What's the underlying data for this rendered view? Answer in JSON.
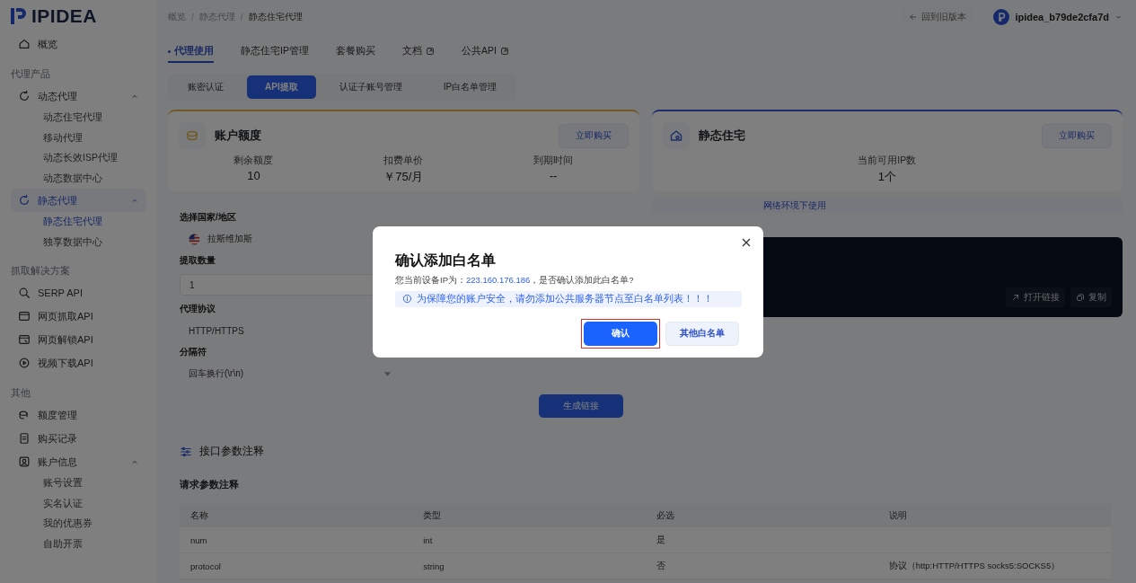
{
  "sidebar": {
    "logo": "IPIDEA",
    "items": [
      {
        "kind": "link",
        "label": "概览",
        "selected": false
      },
      {
        "kind": "section",
        "label": "代理产品"
      },
      {
        "kind": "group",
        "label": "动态代理",
        "expanded": true,
        "selected": false,
        "children": [
          {
            "label": "动态住宅代理",
            "selected": false
          },
          {
            "label": "移动代理",
            "selected": false
          },
          {
            "label": "动态长效ISP代理",
            "selected": false
          },
          {
            "label": "动态数据中心",
            "selected": false
          }
        ]
      },
      {
        "kind": "group",
        "label": "静态代理",
        "expanded": true,
        "selected": true,
        "children": [
          {
            "label": "静态住宅代理",
            "selected": true
          },
          {
            "label": "独享数据中心",
            "selected": false
          }
        ]
      },
      {
        "kind": "section",
        "label": "抓取解决方案"
      },
      {
        "kind": "link",
        "label": "SERP API",
        "selected": false
      },
      {
        "kind": "link",
        "label": "网页抓取API",
        "selected": false
      },
      {
        "kind": "link",
        "label": "网页解锁API",
        "selected": false
      },
      {
        "kind": "link",
        "label": "视频下载API",
        "selected": false
      },
      {
        "kind": "section",
        "label": "其他"
      },
      {
        "kind": "link",
        "label": "额度管理",
        "selected": false
      },
      {
        "kind": "link",
        "label": "购买记录",
        "selected": false
      },
      {
        "kind": "group",
        "label": "账户信息",
        "expanded": true,
        "selected": false,
        "children": [
          {
            "label": "账号设置",
            "selected": false
          },
          {
            "label": "实名认证",
            "selected": false
          },
          {
            "label": "我的优惠券",
            "selected": false
          },
          {
            "label": "自助开票",
            "selected": false
          }
        ]
      }
    ]
  },
  "topbar": {
    "breadcrumb": [
      "概览",
      "静态代理",
      "静态住宅代理"
    ],
    "separator": "/",
    "back_button": "回到旧版本",
    "user": "ipidea_b79de2cfa7d"
  },
  "tabs": [
    {
      "label": "代理使用",
      "selected": true,
      "kind": "plain"
    },
    {
      "label": "静态住宅IP管理",
      "selected": false,
      "kind": "plain"
    },
    {
      "label": "套餐购买",
      "selected": false,
      "kind": "plain"
    },
    {
      "label": "文档",
      "selected": false,
      "kind": "external"
    },
    {
      "label": "公共API",
      "selected": false,
      "kind": "external"
    }
  ],
  "subtabs": [
    {
      "label": "账密认证",
      "selected": false
    },
    {
      "label": "API提取",
      "selected": true
    },
    {
      "label": "认证子账号管理",
      "selected": false
    },
    {
      "label": "IP白名单管理",
      "selected": false
    }
  ],
  "cards": [
    {
      "title": "账户额度",
      "kind": "quota",
      "buy_button": "立即购买",
      "stats": [
        {
          "label": "剩余额度",
          "value": "10"
        },
        {
          "label": "扣费单价",
          "value": "￥75/月"
        },
        {
          "label": "到期时间",
          "value": "--"
        }
      ]
    },
    {
      "title": "静态住宅",
      "kind": "residential",
      "buy_button": "立即购买",
      "stats": [
        {
          "label": "当前可用IP数",
          "value": "1个"
        }
      ]
    }
  ],
  "form": {
    "fields": [
      {
        "label": "选择国家/地区",
        "kind": "country",
        "value": "拉斯维加斯"
      },
      {
        "label": "提取数量",
        "kind": "input",
        "value": "1"
      },
      {
        "label": "代理协议",
        "kind": "option",
        "value": "HTTP/HTTPS"
      },
      {
        "label": "分隔符",
        "kind": "select",
        "value": "回车换行(\\r\\n)"
      }
    ],
    "submit": "生成链接"
  },
  "result": {
    "notice": "网络环境下使用",
    "actions": [
      "打开链接",
      "复制"
    ]
  },
  "docs": {
    "title": "接口参数注释",
    "subtitle": "请求参数注释",
    "columns": [
      "名称",
      "类型",
      "必选",
      "说明"
    ],
    "rows": [
      {
        "cells": [
          "num",
          "int",
          "是"
        ]
      },
      {
        "cells": [
          "protocol",
          "string",
          "否",
          "协议（http:HTTP/HTTPS socks5:SOCKS5）"
        ]
      }
    ]
  },
  "modal": {
    "title": "确认添加白名单",
    "message_before": "您当前设备IP为：",
    "ip": "223.160.176.186",
    "message_after": "，是否确认添加此白名单?",
    "warning": "为保障您的账户安全，请勿添加公共服务器节点至白名单列表！！！",
    "buttons": [
      {
        "label": "确认",
        "kind": "primary",
        "highlighted": true
      },
      {
        "label": "其他白名单",
        "kind": "secondary",
        "highlighted": false
      }
    ]
  }
}
